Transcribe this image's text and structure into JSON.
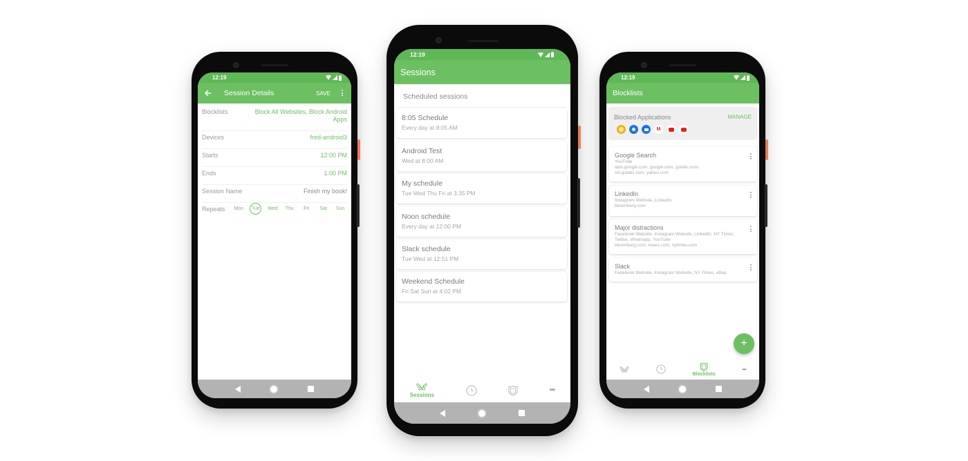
{
  "colors": {
    "accent": "#6cc062",
    "status_bar": "#5fb856",
    "system_nav": "#b3b3b3",
    "power_button": "#f07b5a"
  },
  "status_bar": {
    "time": "12:19",
    "icons": [
      "wifi-icon",
      "signal-icon",
      "battery-icon"
    ]
  },
  "session_details_screen": {
    "title": "Session Details",
    "back_icon": "arrow-left-icon",
    "save_label": "SAVE",
    "menu_icon": "more-vertical-icon",
    "fields": [
      {
        "label": "Blocklists",
        "value": "Block All Websites, Block Android Apps"
      },
      {
        "label": "Devices",
        "value": "fred-android3"
      },
      {
        "label": "Starts",
        "value": "12:00 PM"
      },
      {
        "label": "Ends",
        "value": "1:00 PM"
      },
      {
        "label": "Session Name",
        "value": "Finish my book!"
      }
    ],
    "repeats_label": "Repeats",
    "days": [
      {
        "label": "Mon",
        "selected": false
      },
      {
        "label": "Tue",
        "selected": true
      },
      {
        "label": "Wed",
        "selected": false
      },
      {
        "label": "Thu",
        "selected": false
      },
      {
        "label": "Fri",
        "selected": false
      },
      {
        "label": "Sat",
        "selected": false
      },
      {
        "label": "Sun",
        "selected": false
      }
    ]
  },
  "sessions_screen": {
    "title": "Sessions",
    "section_header": "Scheduled sessions",
    "sessions": [
      {
        "name": "8:05 Schedule",
        "schedule": "Every day at 8:05 AM"
      },
      {
        "name": "Android Test",
        "schedule": "Wed at 8:00 AM"
      },
      {
        "name": "My schedule",
        "schedule": "Tue Wed Thu Fri at 3:35 PM"
      },
      {
        "name": "Noon schedule",
        "schedule": "Every day at 12:00 PM"
      },
      {
        "name": "Slack schedule",
        "schedule": "Tue Wed at 12:51 PM"
      },
      {
        "name": "Weekend Schedule",
        "schedule": "Fri Sat Sun at 4:02 PM"
      }
    ],
    "bottom_nav": [
      {
        "icon": "butterfly-icon",
        "label": "Sessions",
        "active": true
      },
      {
        "icon": "clock-icon",
        "label": "",
        "active": false
      },
      {
        "icon": "shield-icon",
        "label": "",
        "active": false
      },
      {
        "icon": "more-horizontal-icon",
        "label": "",
        "active": false
      }
    ]
  },
  "blocklists_screen": {
    "title": "Blocklists",
    "blocked_applications": {
      "title": "Blocked Applications",
      "manage_label": "MANAGE",
      "app_icons": [
        "google-keep-icon",
        "contacts-icon",
        "duo-icon",
        "gmail-icon",
        "youtube-icon",
        "youtube-icon"
      ]
    },
    "blocklists": [
      {
        "name": "Google Search",
        "lines": [
          "YouTube",
          "apis.google.com, google.com, gstatic.com,",
          "ssl.gstatic.com, yahoo.com"
        ]
      },
      {
        "name": "LinkedIn",
        "lines": [
          "Instagram Website, LinkedIn",
          "bloomberg.com"
        ]
      },
      {
        "name": "Major distractions",
        "lines": [
          "Facebook Website, Instagram Website, LinkedIn, NY Times,",
          "Twitter, Whatsapp, YouTube",
          "bloomberg.com, lowes.com, nytimes.com"
        ]
      },
      {
        "name": "Slack",
        "lines": [
          "Facebook Website, Instagram Website, NY Times, eBay"
        ]
      }
    ],
    "fab_label": "+",
    "bottom_nav": [
      {
        "icon": "butterfly-icon",
        "label": "",
        "active": false
      },
      {
        "icon": "clock-icon",
        "label": "",
        "active": false
      },
      {
        "icon": "shield-icon",
        "label": "Blocklists",
        "active": true
      },
      {
        "icon": "more-horizontal-icon",
        "label": "",
        "active": false
      }
    ]
  }
}
